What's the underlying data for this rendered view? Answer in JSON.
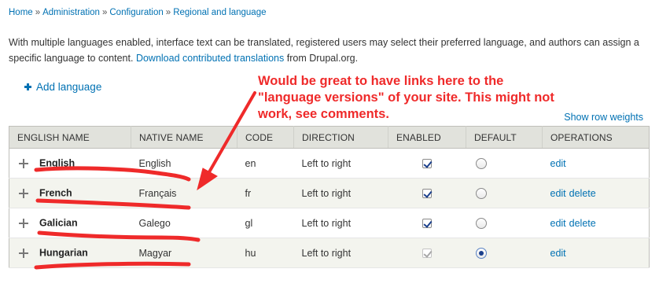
{
  "breadcrumb": {
    "items": [
      "Home",
      "Administration",
      "Configuration",
      "Regional and language"
    ],
    "separator": "»"
  },
  "intro": {
    "text": "With multiple languages enabled, interface text can be translated, registered users may select their preferred language, and authors can assign a specific language to content.",
    "link_text": "Download contributed translations",
    "after_link": "from Drupal.org."
  },
  "actions": {
    "add_language": "Add language",
    "show_row_weights": "Show row weights"
  },
  "table": {
    "headers": [
      "ENGLISH NAME",
      "NATIVE NAME",
      "CODE",
      "DIRECTION",
      "ENABLED",
      "DEFAULT",
      "OPERATIONS"
    ],
    "rows": [
      {
        "english": "English",
        "native": "English",
        "code": "en",
        "direction": "Left to right",
        "enabled": true,
        "default": false,
        "ops": [
          "edit"
        ],
        "op_edit": "edit",
        "op_delete": ""
      },
      {
        "english": "French",
        "native": "Français",
        "code": "fr",
        "direction": "Left to right",
        "enabled": true,
        "default": false,
        "ops": [
          "edit",
          "delete"
        ],
        "op_edit": "edit",
        "op_delete": "delete"
      },
      {
        "english": "Galician",
        "native": "Galego",
        "code": "gl",
        "direction": "Left to right",
        "enabled": true,
        "default": false,
        "ops": [
          "edit",
          "delete"
        ],
        "op_edit": "edit",
        "op_delete": "delete"
      },
      {
        "english": "Hungarian",
        "native": "Magyar",
        "code": "hu",
        "direction": "Left to right",
        "enabled": true,
        "default": true,
        "ops": [
          "edit"
        ],
        "op_edit": "edit",
        "op_delete": ""
      }
    ]
  },
  "annotation": {
    "lines": [
      "Would be great to have links here to the",
      "\"language versions\" of your site. This might not",
      "work, see comments."
    ],
    "color": "#ef2a2a"
  },
  "colors": {
    "link": "#0071b3",
    "header_bg": "#e1e2dc",
    "even_row_bg": "#f3f4ee"
  }
}
